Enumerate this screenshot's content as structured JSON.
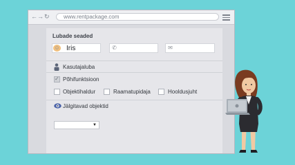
{
  "browser": {
    "url": "www.rentpackage.com",
    "nav_back": "←",
    "nav_forward": "→",
    "nav_reload": "↻"
  },
  "panel": {
    "title": "Lubade seaded",
    "user_name": "Iris",
    "phone_value": "",
    "email_value": "",
    "permission_label": "Kasutajaluba",
    "main_function_label": "Põhifunktsioon",
    "main_function_checked": true,
    "roles": [
      {
        "label": "Objektihaldur",
        "checked": false
      },
      {
        "label": "Raamatupidaja",
        "checked": false
      },
      {
        "label": "Hooldusjuht",
        "checked": false
      }
    ],
    "tracked_label": "Jälgitavad objektid",
    "tracked_select_value": ""
  },
  "icons": {
    "user": "avatar-icon",
    "phone": "phone-icon",
    "email": "envelope-icon",
    "permission": "person-icon",
    "tracked": "eye-icon"
  },
  "colors": {
    "background": "#6cd3d8",
    "panel": "#e6e6ea",
    "chrome": "#eff0f3"
  }
}
